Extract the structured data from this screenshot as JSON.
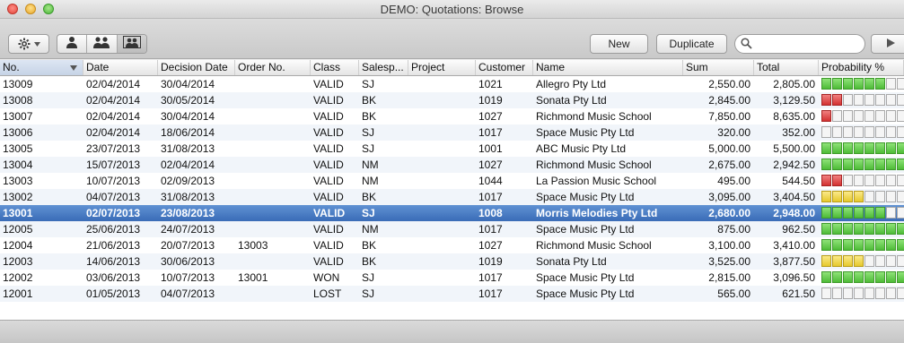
{
  "window": {
    "title": "DEMO: Quotations: Browse"
  },
  "toolbar": {
    "new_label": "New",
    "duplicate_label": "Duplicate",
    "search_placeholder": ""
  },
  "columns": [
    {
      "key": "no",
      "label": "No."
    },
    {
      "key": "date",
      "label": "Date"
    },
    {
      "key": "decision",
      "label": "Decision Date"
    },
    {
      "key": "order",
      "label": "Order No."
    },
    {
      "key": "class",
      "label": "Class"
    },
    {
      "key": "salesp",
      "label": "Salesp..."
    },
    {
      "key": "project",
      "label": "Project"
    },
    {
      "key": "customer",
      "label": "Customer"
    },
    {
      "key": "name",
      "label": "Name"
    },
    {
      "key": "sum",
      "label": "Sum"
    },
    {
      "key": "total",
      "label": "Total"
    },
    {
      "key": "prob",
      "label": "Probability %"
    }
  ],
  "colors": {
    "green": "#4ebc37",
    "red": "#d33131",
    "yellow": "#e6c92c",
    "selection": "#3a6cb7"
  },
  "rows": [
    {
      "no": "13009",
      "date": "02/04/2014",
      "decision": "30/04/2014",
      "order": "",
      "class": "VALID",
      "salesp": "SJ",
      "project": "",
      "customer": "1021",
      "name": "Allegro Pty Ltd",
      "sum": "2,550.00",
      "total": "2,805.00",
      "prob_level": 6,
      "prob_color": "green"
    },
    {
      "no": "13008",
      "date": "02/04/2014",
      "decision": "30/05/2014",
      "order": "",
      "class": "VALID",
      "salesp": "BK",
      "project": "",
      "customer": "1019",
      "name": "Sonata Pty Ltd",
      "sum": "2,845.00",
      "total": "3,129.50",
      "prob_level": 2,
      "prob_color": "red"
    },
    {
      "no": "13007",
      "date": "02/04/2014",
      "decision": "30/04/2014",
      "order": "",
      "class": "VALID",
      "salesp": "BK",
      "project": "",
      "customer": "1027",
      "name": "Richmond Music School",
      "sum": "7,850.00",
      "total": "8,635.00",
      "prob_level": 1,
      "prob_color": "red"
    },
    {
      "no": "13006",
      "date": "02/04/2014",
      "decision": "18/06/2014",
      "order": "",
      "class": "VALID",
      "salesp": "SJ",
      "project": "",
      "customer": "1017",
      "name": "Space Music Pty Ltd",
      "sum": "320.00",
      "total": "352.00",
      "prob_level": 0,
      "prob_color": "green"
    },
    {
      "no": "13005",
      "date": "23/07/2013",
      "decision": "31/08/2013",
      "order": "",
      "class": "VALID",
      "salesp": "SJ",
      "project": "",
      "customer": "1001",
      "name": "ABC Music Pty Ltd",
      "sum": "5,000.00",
      "total": "5,500.00",
      "prob_level": 8,
      "prob_color": "green"
    },
    {
      "no": "13004",
      "date": "15/07/2013",
      "decision": "02/04/2014",
      "order": "",
      "class": "VALID",
      "salesp": "NM",
      "project": "",
      "customer": "1027",
      "name": "Richmond Music School",
      "sum": "2,675.00",
      "total": "2,942.50",
      "prob_level": 8,
      "prob_color": "green"
    },
    {
      "no": "13003",
      "date": "10/07/2013",
      "decision": "02/09/2013",
      "order": "",
      "class": "VALID",
      "salesp": "NM",
      "project": "",
      "customer": "1044",
      "name": "La Passion Music School",
      "sum": "495.00",
      "total": "544.50",
      "prob_level": 2,
      "prob_color": "red"
    },
    {
      "no": "13002",
      "date": "04/07/2013",
      "decision": "31/08/2013",
      "order": "",
      "class": "VALID",
      "salesp": "BK",
      "project": "",
      "customer": "1017",
      "name": "Space Music Pty Ltd",
      "sum": "3,095.00",
      "total": "3,404.50",
      "prob_level": 4,
      "prob_color": "yellow"
    },
    {
      "no": "13001",
      "date": "02/07/2013",
      "decision": "23/08/2013",
      "order": "",
      "class": "VALID",
      "salesp": "SJ",
      "project": "",
      "customer": "1008",
      "name": "Morris Melodies Pty Ltd",
      "sum": "2,680.00",
      "total": "2,948.00",
      "prob_level": 6,
      "prob_color": "green",
      "selected": true
    },
    {
      "no": "12005",
      "date": "25/06/2013",
      "decision": "24/07/2013",
      "order": "",
      "class": "VALID",
      "salesp": "NM",
      "project": "",
      "customer": "1017",
      "name": "Space Music Pty Ltd",
      "sum": "875.00",
      "total": "962.50",
      "prob_level": 8,
      "prob_color": "green"
    },
    {
      "no": "12004",
      "date": "21/06/2013",
      "decision": "20/07/2013",
      "order": "13003",
      "class": "VALID",
      "salesp": "BK",
      "project": "",
      "customer": "1027",
      "name": "Richmond Music School",
      "sum": "3,100.00",
      "total": "3,410.00",
      "prob_level": 8,
      "prob_color": "green"
    },
    {
      "no": "12003",
      "date": "14/06/2013",
      "decision": "30/06/2013",
      "order": "",
      "class": "VALID",
      "salesp": "BK",
      "project": "",
      "customer": "1019",
      "name": "Sonata Pty Ltd",
      "sum": "3,525.00",
      "total": "3,877.50",
      "prob_level": 4,
      "prob_color": "yellow"
    },
    {
      "no": "12002",
      "date": "03/06/2013",
      "decision": "10/07/2013",
      "order": "13001",
      "class": "WON",
      "salesp": "SJ",
      "project": "",
      "customer": "1017",
      "name": "Space Music Pty Ltd",
      "sum": "2,815.00",
      "total": "3,096.50",
      "prob_level": 8,
      "prob_color": "green"
    },
    {
      "no": "12001",
      "date": "01/05/2013",
      "decision": "04/07/2013",
      "order": "",
      "class": "LOST",
      "salesp": "SJ",
      "project": "",
      "customer": "1017",
      "name": "Space Music Pty Ltd",
      "sum": "565.00",
      "total": "621.50",
      "prob_level": 0,
      "prob_color": "green"
    }
  ]
}
